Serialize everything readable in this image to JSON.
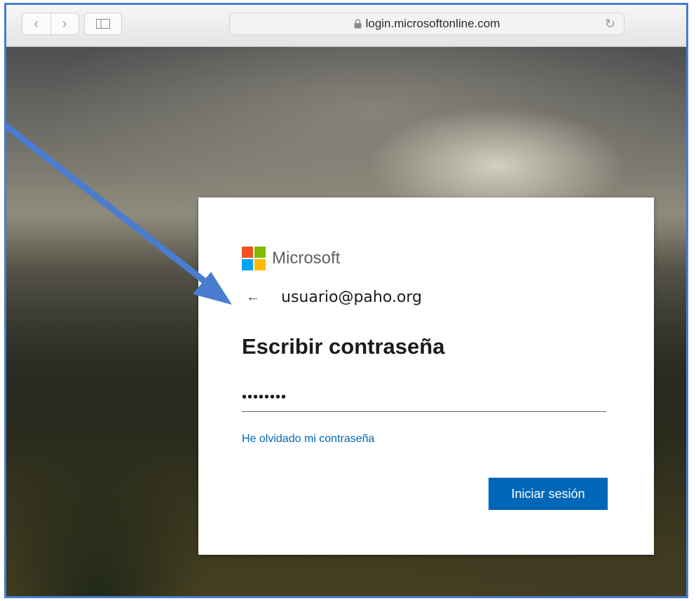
{
  "browser": {
    "url": "login.microsoftonline.com",
    "back_glyph": "‹",
    "forward_glyph": "›",
    "reload_glyph": "↻"
  },
  "login": {
    "brand": "Microsoft",
    "brand_colors": [
      "#f25022",
      "#7fba00",
      "#00a4ef",
      "#ffb900"
    ],
    "back_glyph": "←",
    "email": "usuario@paho.org",
    "title": "Escribir contraseña",
    "password_mask": "••••••••",
    "forgot_link": "He olvidado mi contraseña",
    "signin_button": "Iniciar sesión",
    "accent_color": "#0067b8"
  },
  "annotation": {
    "arrow_color": "#4a7ccf"
  }
}
